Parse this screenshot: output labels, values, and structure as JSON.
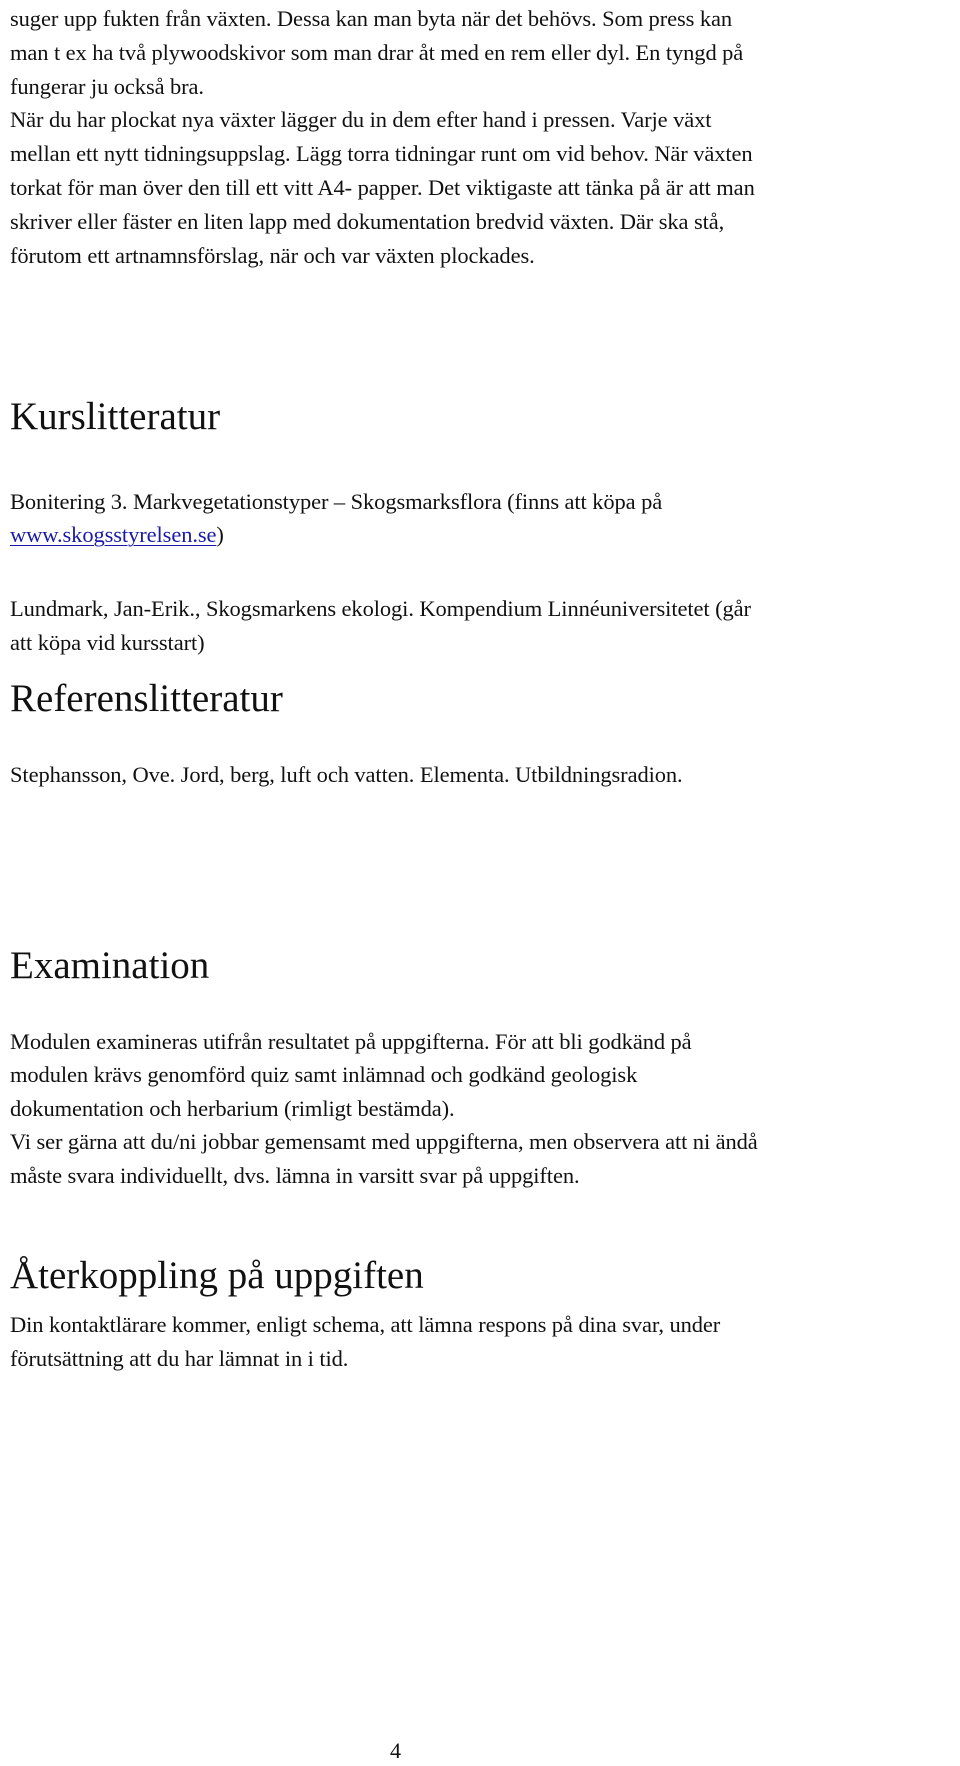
{
  "intro_paragraph": {
    "lines": [
      "suger upp fukten från växten. Dessa kan man byta när det behövs. Som press kan",
      "man t ex ha två plywoodskivor som man drar åt med en rem eller dyl. En tyngd på",
      "fungerar ju också bra.",
      "När du har plockat nya växter lägger du in dem efter hand i pressen. Varje växt",
      "mellan ett nytt tidningsuppslag. Lägg torra tidningar runt om vid behov. När växten",
      "torkat för man över den till ett vitt A4- papper. Det viktigaste att tänka på är att man",
      "skriver eller fäster en liten lapp med dokumentation bredvid växten. Där ska stå,",
      "förutom ett artnamnsförslag, när och var växten plockades."
    ]
  },
  "kurslitteratur": {
    "heading": "Kurslitteratur",
    "item1_line1": "Bonitering 3. Markvegetationstyper – Skogsmarksflora (finns att köpa på",
    "item1_link": "www.skogsstyrelsen.se",
    "item1_after_link": ")",
    "item2_line1": "Lundmark, Jan-Erik., Skogsmarkens ekologi. Kompendium Linnéuniversitetet (går",
    "item2_line2": "att köpa vid kursstart)"
  },
  "referenslitteratur": {
    "heading": "Referenslitteratur",
    "item1": "Stephansson, Ove. Jord, berg, luft och vatten. Elementa. Utbildningsradion."
  },
  "examination": {
    "heading": "Examination",
    "lines": [
      "Modulen examineras utifrån resultatet på uppgifterna. För att bli godkänd på",
      "modulen krävs genomförd quiz samt inlämnad och godkänd geologisk",
      "dokumentation och herbarium (rimligt bestämda).",
      "Vi ser gärna att du/ni jobbar gemensamt med uppgifterna, men observera att ni ändå",
      "måste svara individuellt, dvs. lämna in varsitt svar på uppgiften."
    ]
  },
  "aterkoppling": {
    "heading": "Återkoppling på uppgiften",
    "lines": [
      "Din kontaktlärare kommer, enligt schema, att lämna respons på dina svar, under",
      "förutsättning att du har lämnat in i tid."
    ]
  },
  "footer": {
    "page_number": "4"
  },
  "colors": {
    "text": "#111111",
    "link": "#1a1aa6",
    "background": "#ffffff"
  }
}
